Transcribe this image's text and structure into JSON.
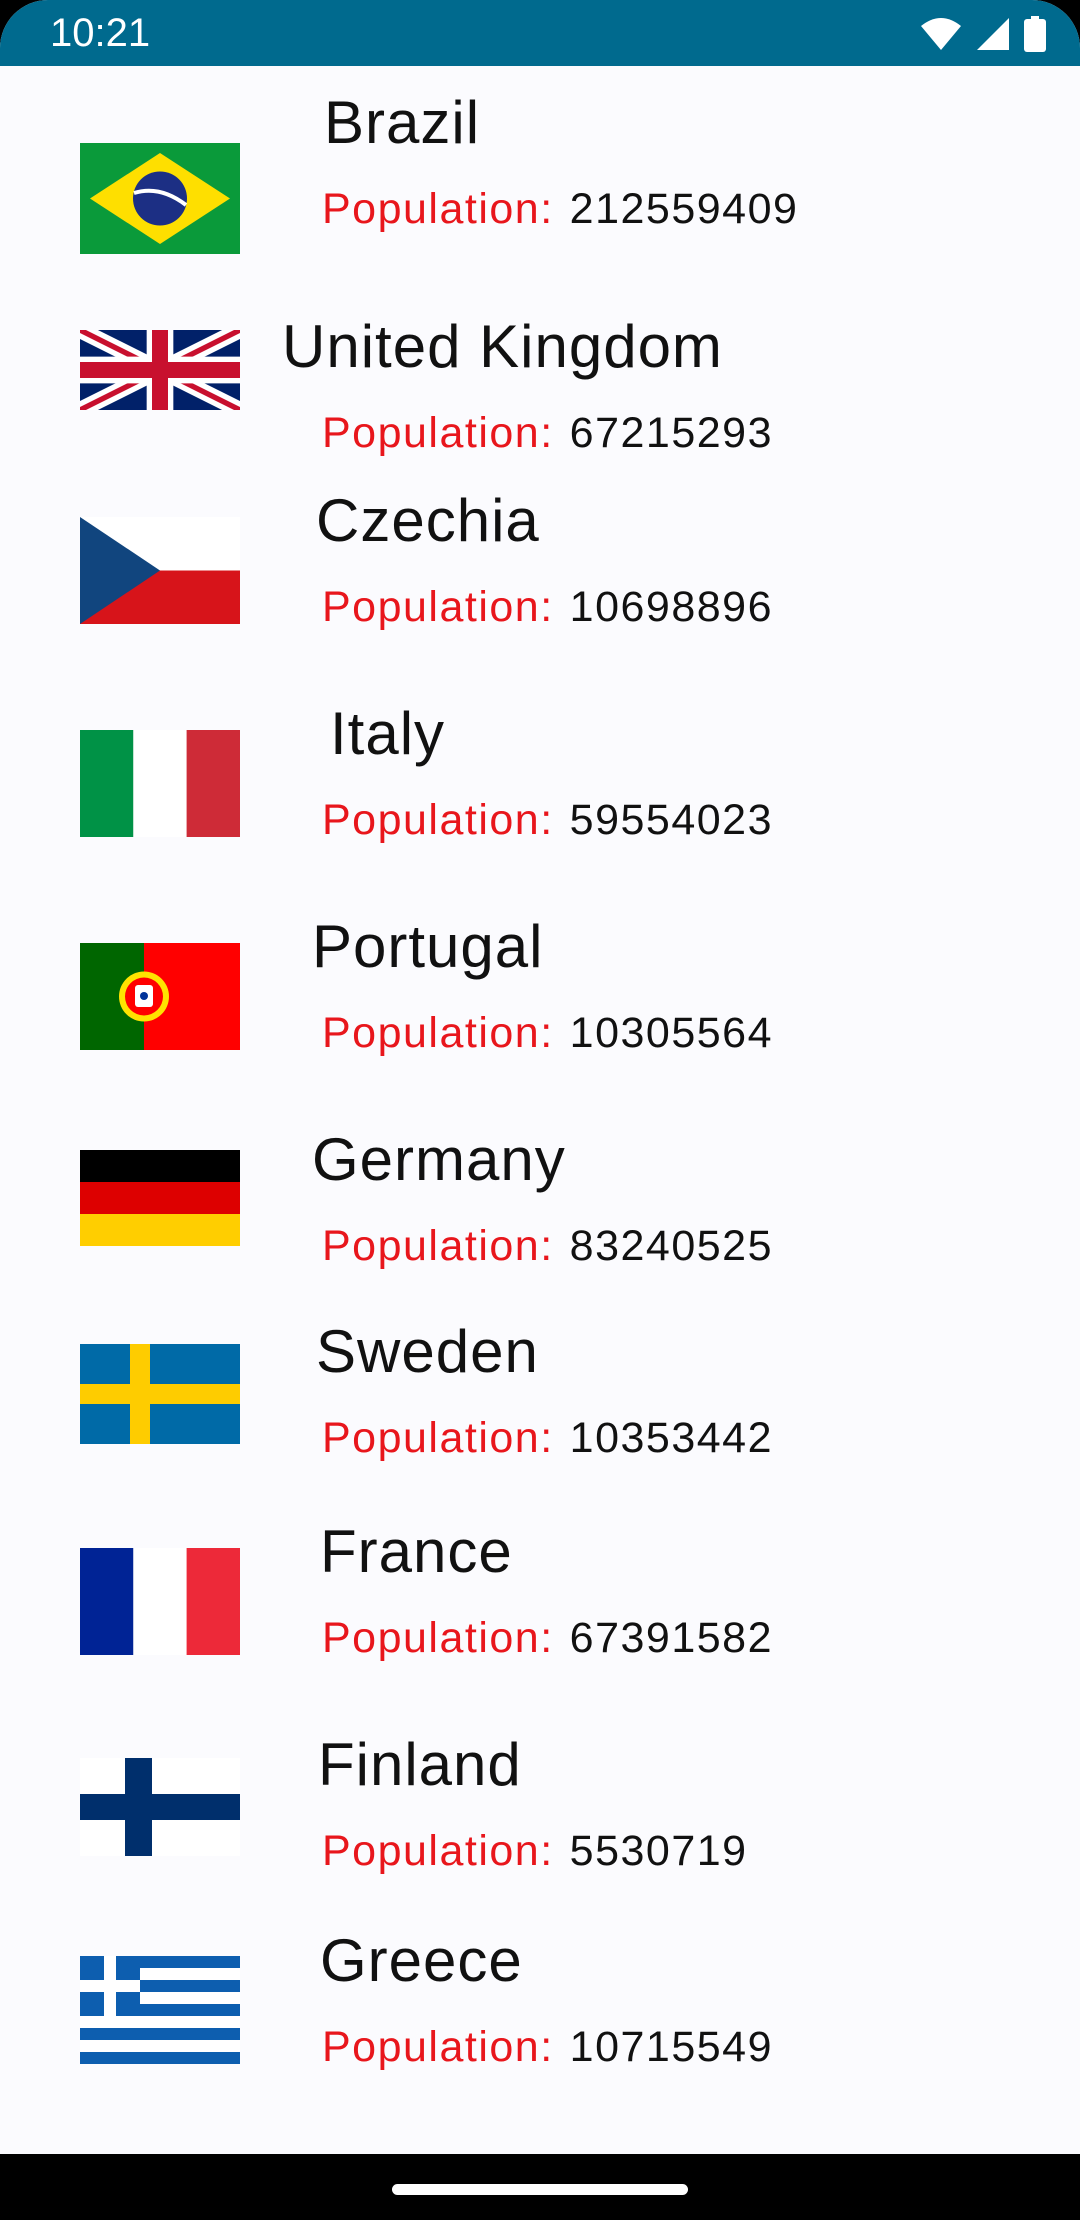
{
  "status_bar": {
    "time": "10:21",
    "icons": [
      "wifi-icon",
      "cell-signal-icon",
      "battery-icon"
    ]
  },
  "countries": [
    {
      "name": "Brazil",
      "population_label": "Population:",
      "population": "212559409",
      "flag": "brazil-flag-icon"
    },
    {
      "name": "United Kingdom",
      "population_label": "Population:",
      "population": "67215293",
      "flag": "united-kingdom-flag-icon"
    },
    {
      "name": "Czechia",
      "population_label": "Population:",
      "population": "10698896",
      "flag": "czechia-flag-icon"
    },
    {
      "name": "Italy",
      "population_label": "Population:",
      "population": "59554023",
      "flag": "italy-flag-icon"
    },
    {
      "name": "Portugal",
      "population_label": "Population:",
      "population": "10305564",
      "flag": "portugal-flag-icon"
    },
    {
      "name": "Germany",
      "population_label": "Population:",
      "population": "83240525",
      "flag": "germany-flag-icon"
    },
    {
      "name": "Sweden",
      "population_label": "Population:",
      "population": "10353442",
      "flag": "sweden-flag-icon"
    },
    {
      "name": "France",
      "population_label": "Population:",
      "population": "67391582",
      "flag": "france-flag-icon"
    },
    {
      "name": "Finland",
      "population_label": "Population:",
      "population": "5530719",
      "flag": "finland-flag-icon"
    },
    {
      "name": "Greece",
      "population_label": "Population:",
      "population": "10715549",
      "flag": "greece-flag-icon"
    }
  ],
  "colors": {
    "status_bar": "#006a8e",
    "background": "#fbfbfe",
    "population_label": "#e8161c",
    "text": "#111111",
    "nav_bar": "#000000"
  }
}
